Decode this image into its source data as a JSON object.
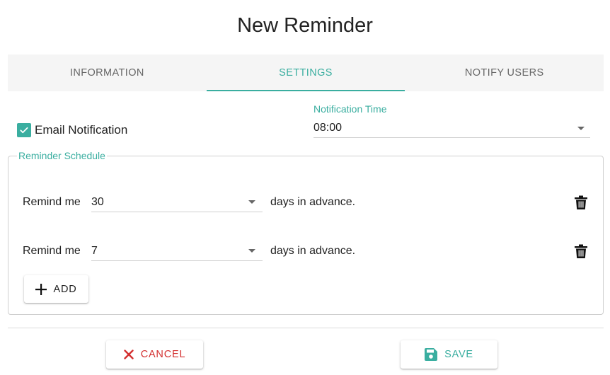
{
  "dialog": {
    "title": "New Reminder"
  },
  "tabs": [
    {
      "label": "INFORMATION",
      "active": false
    },
    {
      "label": "SETTINGS",
      "active": true
    },
    {
      "label": "NOTIFY USERS",
      "active": false
    }
  ],
  "email_notification": {
    "label": "Email Notification",
    "checked": true
  },
  "notification_time": {
    "label": "Notification Time",
    "value": "08:00"
  },
  "reminder_schedule": {
    "legend": "Reminder Schedule",
    "rows": [
      {
        "prefix": "Remind me",
        "value": "30",
        "suffix": "days in advance."
      },
      {
        "prefix": "Remind me",
        "value": "7",
        "suffix": "days in advance."
      }
    ],
    "add_label": "ADD"
  },
  "footer": {
    "cancel_label": "CANCEL",
    "save_label": "SAVE"
  },
  "colors": {
    "accent": "#3aaea0",
    "danger": "#d32f2f",
    "text": "#212121"
  },
  "icons": {
    "checkbox": "check-icon",
    "dropdown": "caret-down-icon",
    "delete": "trash-icon",
    "add": "plus-icon",
    "cancel": "close-icon",
    "save": "floppy-disk-icon"
  }
}
